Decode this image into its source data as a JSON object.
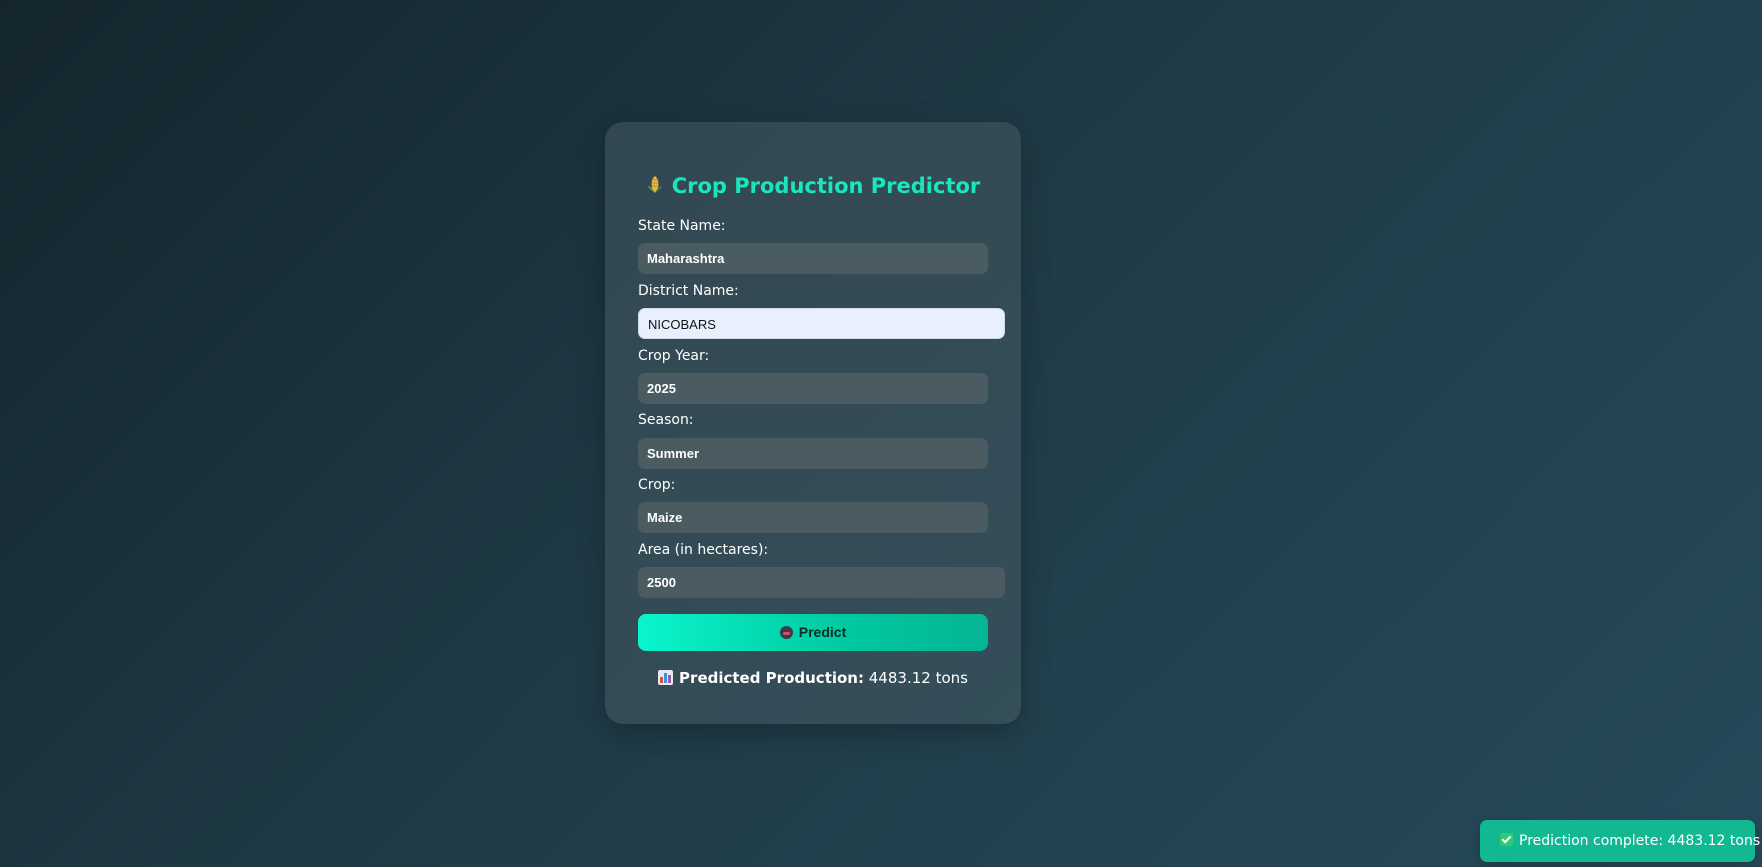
{
  "app": {
    "title": "Crop Production Predictor"
  },
  "form": {
    "state": {
      "label": "State Name:",
      "value": "Maharashtra"
    },
    "district": {
      "label": "District Name:",
      "value": "NICOBARS"
    },
    "year": {
      "label": "Crop Year:",
      "value": "2025"
    },
    "season": {
      "label": "Season:",
      "value": "Summer"
    },
    "crop": {
      "label": "Crop:",
      "value": "Maize"
    },
    "area": {
      "label": "Area (in hectares):",
      "value": "2500"
    },
    "predict_label": "Predict"
  },
  "result": {
    "label": "Predicted Production:",
    "value": "4483.12 tons"
  },
  "toast": {
    "message": "Prediction complete: 4483.12 tons"
  },
  "colors": {
    "accent": "#19e6bf",
    "button": "#00c89f",
    "toast": "#11b892"
  },
  "icons": {
    "title": "corn-icon",
    "predict": "robot-icon",
    "result": "bar-chart-icon",
    "toast": "checkmark-icon"
  }
}
